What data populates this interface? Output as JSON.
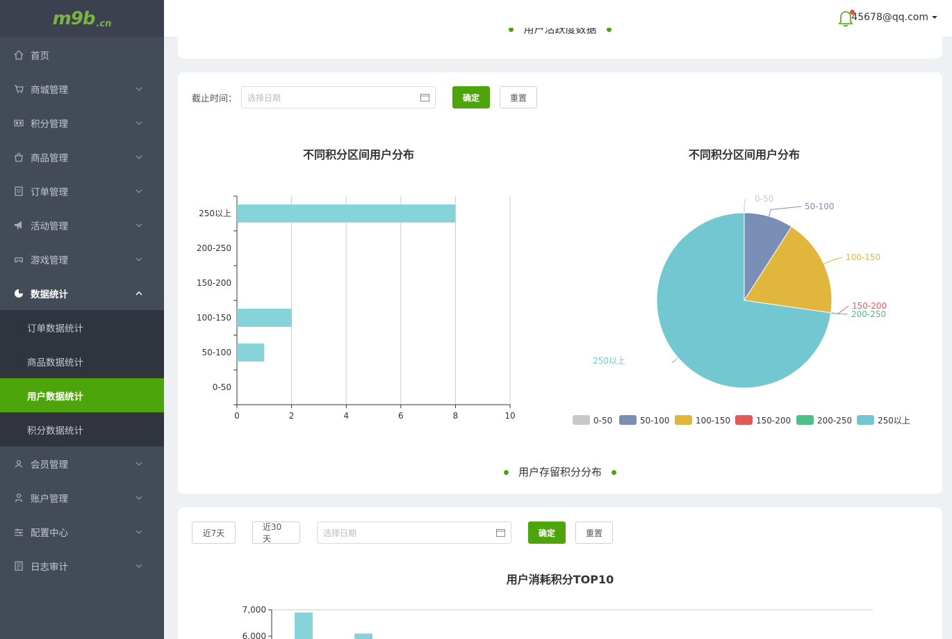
{
  "logo": {
    "mark": "m9b",
    "tld": ".cn"
  },
  "sidebar": {
    "items": [
      {
        "label": "首页",
        "icon": "home-icon"
      },
      {
        "label": "商城管理",
        "icon": "cart-icon"
      },
      {
        "label": "积分管理",
        "icon": "points-icon"
      },
      {
        "label": "商品管理",
        "icon": "bag-icon"
      },
      {
        "label": "订单管理",
        "icon": "order-icon"
      },
      {
        "label": "活动管理",
        "icon": "megaphone-icon"
      },
      {
        "label": "游戏管理",
        "icon": "gamepad-icon"
      },
      {
        "label": "数据统计",
        "icon": "pie-icon"
      },
      {
        "label": "会员管理",
        "icon": "member-icon"
      },
      {
        "label": "账户管理",
        "icon": "user-icon"
      },
      {
        "label": "配置中心",
        "icon": "sliders-icon"
      },
      {
        "label": "日志审计",
        "icon": "log-icon"
      }
    ],
    "sub_items": [
      "订单数据统计",
      "商品数据统计",
      "用户数据统计",
      "积分数据统计"
    ],
    "selected_sub": "用户数据统计"
  },
  "header": {
    "user_email": "45678@qq.com"
  },
  "top_card": {
    "partial_title": "用户活跃度数据"
  },
  "filter1": {
    "label": "截止时间：",
    "date_placeholder": "选择日期",
    "confirm": "确定",
    "reset": "重置"
  },
  "section2_title": "用户存留积分分布",
  "filter2": {
    "btn_7": "近7天",
    "btn_30": "近30天",
    "date_placeholder": "选择日期",
    "confirm": "确定",
    "reset": "重置"
  },
  "colors": {
    "accent": "#4ea50b",
    "bar": "#86d3da",
    "pie": [
      "#c8c8c8",
      "#7a8fb5",
      "#e0b63d",
      "#e05a5a",
      "#4fc085",
      "#72c7d0"
    ]
  },
  "chart_data": [
    {
      "type": "bar",
      "title": "不同积分区间用户分布",
      "orientation": "horizontal",
      "categories": [
        "0-50",
        "50-100",
        "100-150",
        "150-200",
        "200-250",
        "250以上"
      ],
      "values": [
        0,
        1,
        2,
        0,
        0,
        8
      ],
      "xlim": [
        0,
        10
      ],
      "xticks": [
        0,
        2,
        4,
        6,
        8,
        10
      ],
      "grid": true
    },
    {
      "type": "pie",
      "title": "不同积分区间用户分布",
      "categories": [
        "0-50",
        "50-100",
        "100-150",
        "150-200",
        "200-250",
        "250以上"
      ],
      "values": [
        0,
        1,
        2,
        0,
        0,
        8
      ],
      "legend": "bottom"
    },
    {
      "type": "bar",
      "title": "用户消耗积分TOP10",
      "yticks": [
        "7,000",
        "6,000"
      ],
      "visible_values": [
        6900,
        6100
      ],
      "ylim": [
        0,
        7000
      ]
    }
  ]
}
